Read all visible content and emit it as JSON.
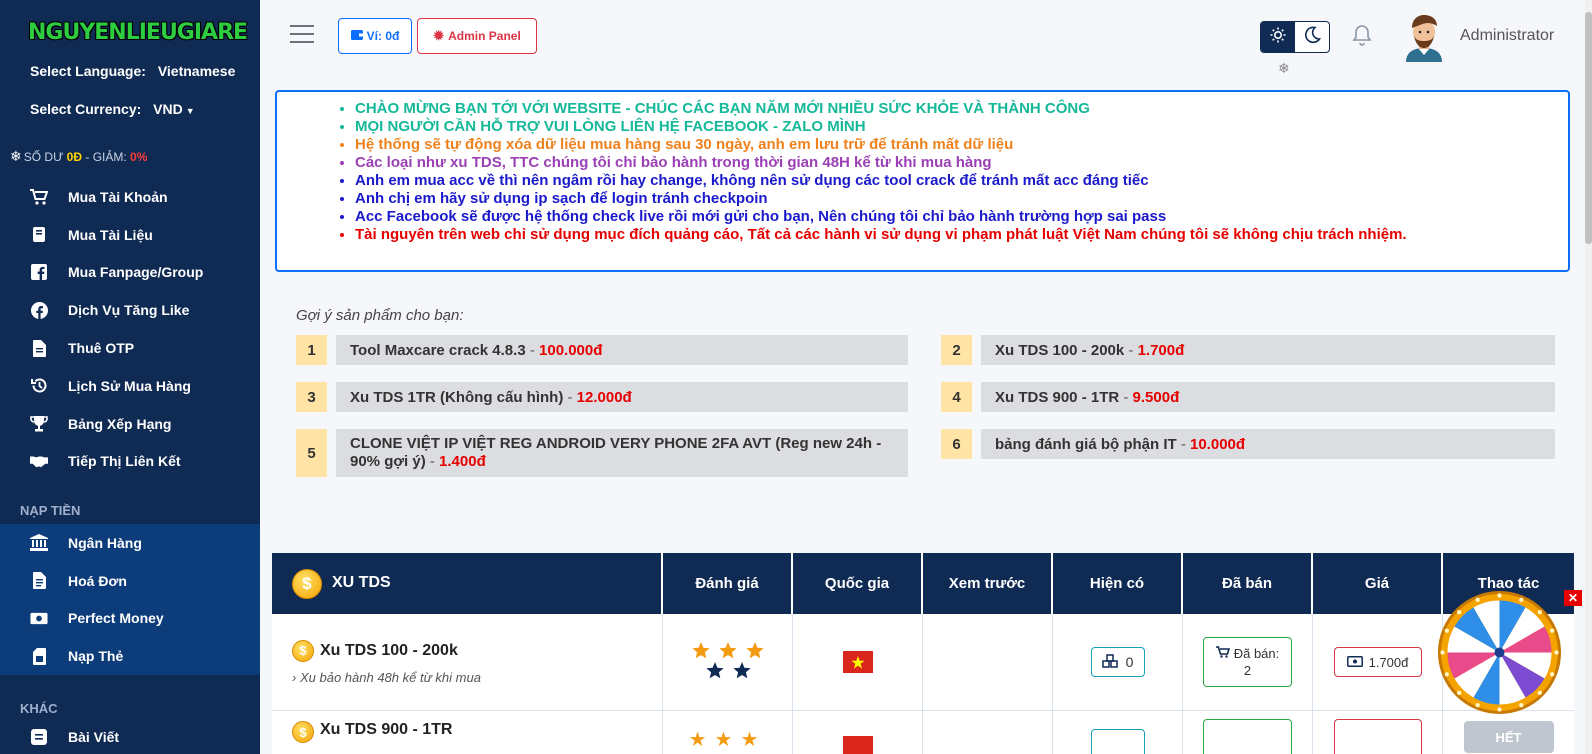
{
  "brand": {
    "logo_text": "NGUYENLIEUGIARE"
  },
  "sidebar": {
    "language_label": "Select Language:",
    "language_value": "Vietnamese",
    "currency_label": "Select Currency:",
    "currency_value": "VND",
    "balance_label": "SỐ DƯ",
    "balance_value": "0Đ",
    "discount_label": "- GIẢM:",
    "discount_value": "0%",
    "items": [
      {
        "label": "Mua Tài Khoản",
        "icon": "cart-icon"
      },
      {
        "label": "Mua Tài Liệu",
        "icon": "book-icon"
      },
      {
        "label": "Mua Fanpage/Group",
        "icon": "facebook-square-icon"
      },
      {
        "label": "Dịch Vụ Tăng Like",
        "icon": "facebook-circle-icon"
      },
      {
        "label": "Thuê OTP",
        "icon": "document-icon"
      },
      {
        "label": "Lịch Sử Mua Hàng",
        "icon": "history-icon"
      },
      {
        "label": "Bảng Xếp Hạng",
        "icon": "trophy-icon"
      },
      {
        "label": "Tiếp Thị Liên Kết",
        "icon": "handshake-icon"
      }
    ],
    "section_nap_tien": "NẠP TIỀN",
    "deposit_items": [
      {
        "label": "Ngân Hàng",
        "icon": "bank-icon"
      },
      {
        "label": "Hoá Đơn",
        "icon": "invoice-icon"
      },
      {
        "label": "Perfect Money",
        "icon": "money-icon"
      },
      {
        "label": "Nạp Thẻ",
        "icon": "sim-card-icon"
      }
    ],
    "section_khac": "KHÁC",
    "other_items": [
      {
        "label": "Bài Viết",
        "icon": "blog-icon"
      }
    ]
  },
  "header": {
    "wallet_label": "Ví: 0đ",
    "admin_panel_label": "Admin Panel",
    "user_name": "Administrator"
  },
  "notice": {
    "lines": [
      {
        "text": "CHÀO MỪNG BẠN TỚI VỚI WEBSITE - CHÚC CÁC BẠN NĂM MỚI NHIỀU SỨC KHỎE VÀ THÀNH CÔNG",
        "color": "#16b89a"
      },
      {
        "text": "MỌI NGƯỜI CẦN HỖ TRỢ VUI LÒNG LIÊN HỆ FACEBOOK - ZALO MÌNH",
        "color": "#16b89a"
      },
      {
        "text": "Hệ thống sẽ tự động xóa dữ liệu mua hàng sau 30 ngày, anh em lưu trữ để tránh mất dữ liệu",
        "color": "#f0821e"
      },
      {
        "text": "Các loại như xu TDS, TTC chúng tôi chỉ bảo hành trong thời gian 48H kể từ khi mua hàng",
        "color": "#9b40b5"
      },
      {
        "text": "Anh em mua acc về thì nên ngâm rồi hay change, không nên sử dụng các tool crack để tránh mất acc đáng tiếc",
        "color": "#1a1acc"
      },
      {
        "text": "Anh chị em hãy sử dụng ip sạch để login tránh checkpoin",
        "color": "#1a1acc"
      },
      {
        "text": "Acc Facebook sẽ được hệ thống check live rồi mới gửi cho bạn, Nên chúng tôi chỉ bảo hành trường hợp sai pass",
        "color": "#1a1acc"
      },
      {
        "text": "Tài nguyên trên web chỉ sử dụng mục đích quảng cáo, Tất cả các hành vi sử dụng vi phạm phát luật Việt Nam chúng tôi sẽ không chịu trách nhiệm.",
        "color": "#e60000"
      }
    ]
  },
  "suggestions": {
    "title": "Gợi ý sản phẩm cho bạn:",
    "items": [
      {
        "num": "1",
        "name": "Tool Maxcare crack 4.8.3",
        "price": "100.000đ"
      },
      {
        "num": "2",
        "name": "Xu TDS 100 - 200k",
        "price": "1.700đ"
      },
      {
        "num": "3",
        "name": "Xu TDS 1TR (Không cấu hình)",
        "price": "12.000đ"
      },
      {
        "num": "4",
        "name": "Xu TDS 900 - 1TR",
        "price": "9.500đ"
      },
      {
        "num": "5",
        "name": "CLONE VIỆT IP VIỆT REG ANDROID VERY PHONE 2FA AVT (Reg new 24h - 90% gợi ý)",
        "price": "1.400đ"
      },
      {
        "num": "6",
        "name": "bảng đánh giá bộ phận IT",
        "price": "10.000đ"
      }
    ]
  },
  "table": {
    "category": "XU TDS",
    "columns": [
      "Đánh giá",
      "Quốc gia",
      "Xem trước",
      "Hiện có",
      "Đã bán",
      "Giá",
      "Thao tác"
    ],
    "rows": [
      {
        "name": "Xu TDS 100 - 200k",
        "desc": "Xu bảo hành 48h kể từ khi mua",
        "stars_filled": 3,
        "stars_total": 5,
        "stock": "0",
        "sold_label": "Đã bán:",
        "sold": "2",
        "price": "1.700đ"
      },
      {
        "name": "Xu TDS 900 - 1TR",
        "action": "HẾT"
      }
    ]
  },
  "colors": {
    "sidebar": "#0f2a53",
    "accent": "#0d6efd",
    "danger": "#dc3545",
    "price": "#e60000"
  }
}
